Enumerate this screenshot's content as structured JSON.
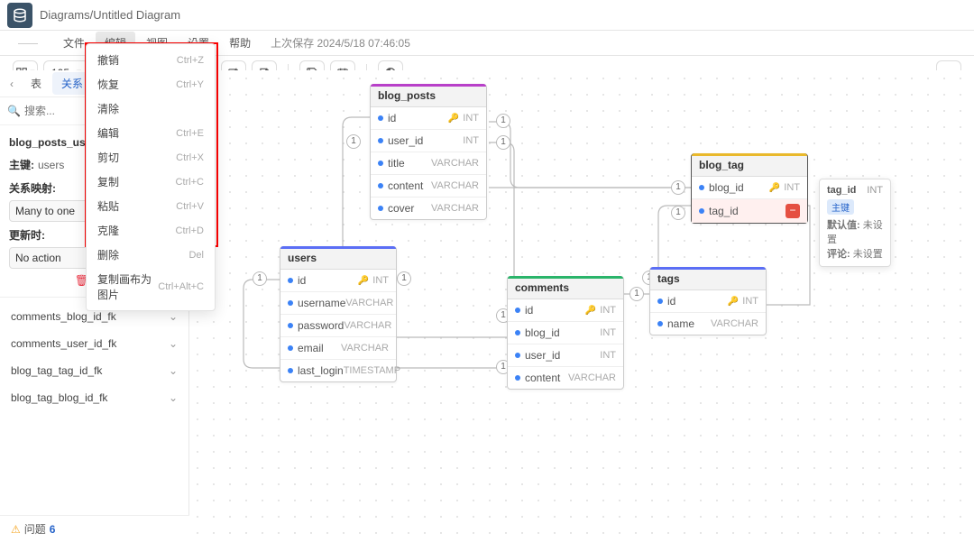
{
  "header": {
    "breadcrumb": "Diagrams/Untitled Diagram"
  },
  "menu": {
    "file": "文件",
    "edit": "编辑",
    "view": "视图",
    "settings": "设置",
    "help": "帮助",
    "last_save_label": "上次保存",
    "last_save_time": "2024/5/18 07:46:05"
  },
  "toolbar": {
    "zoom": "105"
  },
  "edit_menu": {
    "items": [
      {
        "label": "撤销",
        "shortcut": "Ctrl+Z"
      },
      {
        "label": "恢复",
        "shortcut": "Ctrl+Y"
      },
      {
        "label": "清除",
        "shortcut": ""
      },
      {
        "label": "编辑",
        "shortcut": "Ctrl+E"
      },
      {
        "label": "剪切",
        "shortcut": "Ctrl+X"
      },
      {
        "label": "复制",
        "shortcut": "Ctrl+C"
      },
      {
        "label": "粘贴",
        "shortcut": "Ctrl+V"
      },
      {
        "label": "克隆",
        "shortcut": "Ctrl+D"
      },
      {
        "label": "删除",
        "shortcut": "Del"
      },
      {
        "label": "复制画布为图片",
        "shortcut": "Ctrl+Alt+C"
      }
    ]
  },
  "sidebar": {
    "tab_table": "表",
    "tab_relation": "关系",
    "search_placeholder": "搜索...",
    "selected_fk": "blog_posts_user_id_fk",
    "pk_label": "主键:",
    "pk_value": "users",
    "mapping_label": "关系映射:",
    "mapping_value": "Many to one",
    "update_label": "更新时:",
    "update_value": "No action",
    "delete_label": "删除",
    "fk_items": [
      "comments_blog_id_fk",
      "comments_user_id_fk",
      "blog_tag_tag_id_fk",
      "blog_tag_blog_id_fk"
    ]
  },
  "footer": {
    "label": "问题",
    "count": "6"
  },
  "tables": {
    "blog_posts": {
      "title": "blog_posts",
      "rows": [
        {
          "name": "id",
          "type": "INT",
          "pk": true
        },
        {
          "name": "user_id",
          "type": "INT"
        },
        {
          "name": "title",
          "type": "VARCHAR"
        },
        {
          "name": "content",
          "type": "VARCHAR"
        },
        {
          "name": "cover",
          "type": "VARCHAR"
        }
      ]
    },
    "users": {
      "title": "users",
      "rows": [
        {
          "name": "id",
          "type": "INT",
          "pk": true
        },
        {
          "name": "username",
          "type": "VARCHAR"
        },
        {
          "name": "password",
          "type": "VARCHAR"
        },
        {
          "name": "email",
          "type": "VARCHAR"
        },
        {
          "name": "last_login",
          "type": "TIMESTAMP"
        }
      ]
    },
    "comments": {
      "title": "comments",
      "rows": [
        {
          "name": "id",
          "type": "INT",
          "pk": true
        },
        {
          "name": "blog_id",
          "type": "INT"
        },
        {
          "name": "user_id",
          "type": "INT"
        },
        {
          "name": "content",
          "type": "VARCHAR"
        }
      ]
    },
    "blog_tag": {
      "title": "blog_tag",
      "rows": [
        {
          "name": "blog_id",
          "type": "INT",
          "pk": true
        },
        {
          "name": "tag_id",
          "type": "",
          "deletable": true
        }
      ]
    },
    "tags": {
      "title": "tags",
      "rows": [
        {
          "name": "id",
          "type": "INT",
          "pk": true
        },
        {
          "name": "name",
          "type": "VARCHAR"
        }
      ]
    }
  },
  "tooltip": {
    "field": "tag_id",
    "type": "INT",
    "pk_badge": "主键",
    "default_label": "默认值:",
    "default_value": "未设置",
    "comment_label": "评论:",
    "comment_value": "未设置"
  },
  "conn_label": "1"
}
